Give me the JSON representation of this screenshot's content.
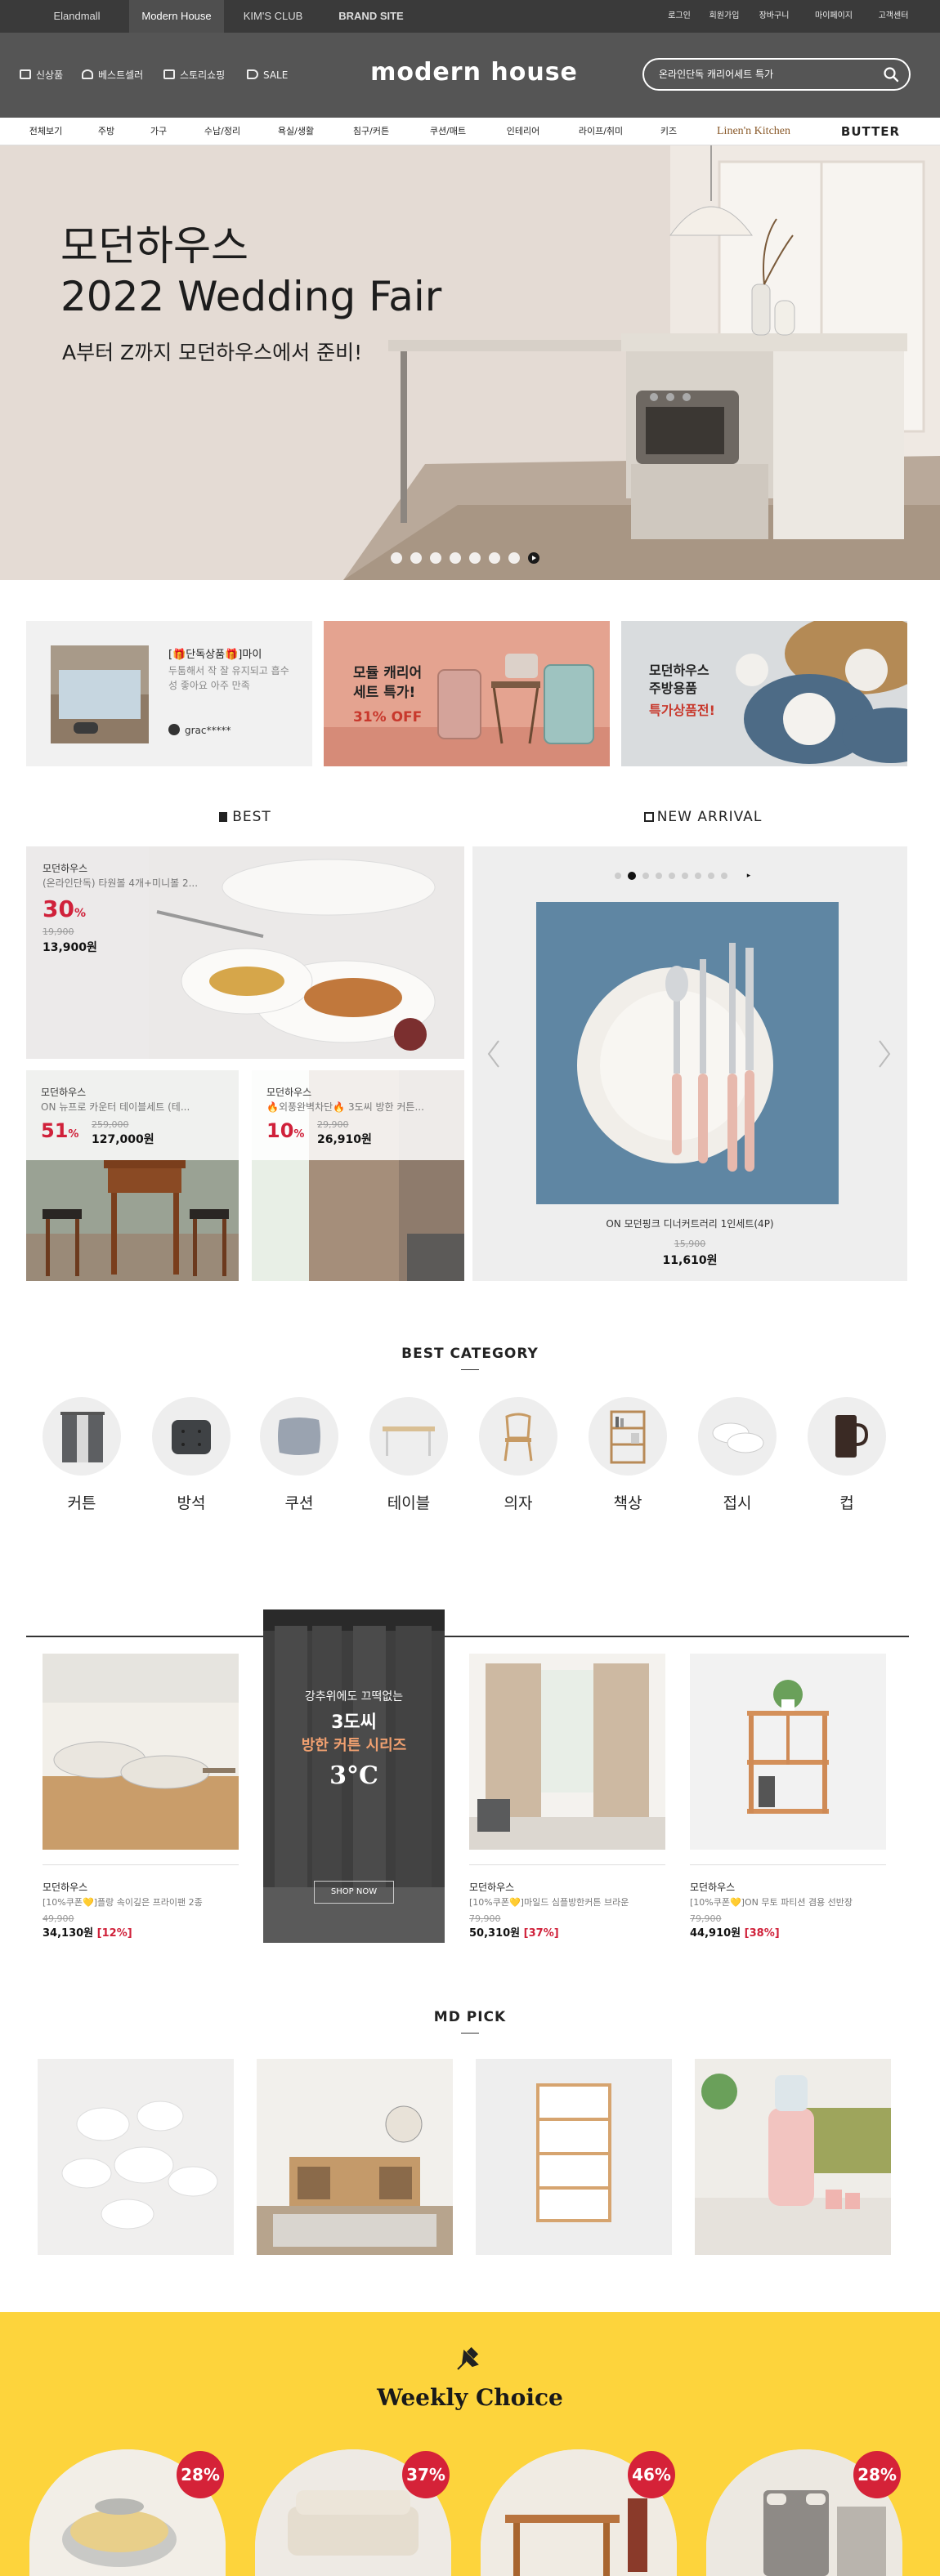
{
  "topbar": {
    "brands": [
      "Elandmall",
      "Modern House",
      "KIM'S CLUB",
      "BRAND SITE"
    ],
    "links": [
      "로그인",
      "회원가입",
      "장바구니",
      "마이페이지",
      "고객센터"
    ]
  },
  "header": {
    "shortcuts": [
      "신상품",
      "베스트셀러",
      "스토리쇼핑",
      "SALE"
    ],
    "logo": "modern house",
    "search_placeholder": "온라인단독 캐리어세트 특가"
  },
  "catnav": [
    "전체보기",
    "주방",
    "가구",
    "수납/정리",
    "욕실/생활",
    "침구/커튼",
    "쿠션/매트",
    "인테리어",
    "라이프/취미",
    "키즈",
    "Linen'n Kitchen",
    "BUTTER"
  ],
  "hero": {
    "title_line1": "모던하우스",
    "title_line2": "2022 Wedding Fair",
    "subtitle": "A부터 Z까지 모던하우스에서 준비!",
    "dot_count": 7
  },
  "promos": {
    "review": {
      "title": "[🎁단독상품🎁]마이",
      "text": "두툼해서 작 잘 유지되고 흡수성 좋아요 아주 만족",
      "user": "grac*****"
    },
    "carrier": {
      "line1": "모듈 캐리어",
      "line2": "세트 특가!",
      "discount": "31% OFF"
    },
    "kitchen": {
      "line1": "모던하우스",
      "line2": "주방용품",
      "line3": "특가상품전!"
    }
  },
  "best": {
    "heading": "BEST",
    "items": [
      {
        "brand": "모던하우스",
        "desc": "(온라인단독) 타원볼 4개+미니볼 2...",
        "pct": "30",
        "old": "19,900",
        "price": "13,900원"
      },
      {
        "brand": "모던하우스",
        "desc": "ON 뉴프로 카운터 테이블세트 (테...",
        "pct": "51",
        "old": "259,000",
        "price": "127,000원"
      },
      {
        "brand": "모던하우스",
        "desc": "🔥외풍완벽차단🔥 3도씨 방한 커튼...",
        "pct": "10",
        "old": "29,900",
        "price": "26,910원"
      }
    ]
  },
  "new_arrival": {
    "heading": "NEW ARRIVAL",
    "name": "ON 모던핑크 디너커트러리 1인세트(4P)",
    "old": "15,900",
    "price": "11,610원",
    "dot_count": 10
  },
  "best_category": {
    "heading": "BEST CATEGORY",
    "items": [
      "커튼",
      "방석",
      "쿠션",
      "테이블",
      "의자",
      "책상",
      "접시",
      "컵"
    ]
  },
  "curtain_banner": {
    "line1": "강추위에도 끄떡없는",
    "line2": "3도씨",
    "line3": "방한 커튼 시리즈",
    "badge": "3°C",
    "button": "SHOP NOW"
  },
  "products": [
    {
      "brand": "모던하우스",
      "desc": "[10%쿠폰💛]플랑 속이깊은 프라이팬 2종",
      "old": "49,900",
      "price": "34,130원",
      "disc": "[12%]"
    },
    {
      "brand": "모던하우스",
      "desc": "[10%쿠폰💛]마일드 심플방한커튼 브라운",
      "old": "79,900",
      "price": "50,310원",
      "disc": "[37%]"
    },
    {
      "brand": "모던하우스",
      "desc": "[10%쿠폰💛]ON 무토 파티션 겸용 선반장",
      "old": "79,900",
      "price": "44,910원",
      "disc": "[38%]"
    }
  ],
  "md_pick": {
    "heading": "MD PICK"
  },
  "weekly": {
    "heading": "Weekly Choice",
    "badges": [
      "28%",
      "37%",
      "46%",
      "28%"
    ]
  },
  "colors": {
    "accent": "#d0213a",
    "header_bg": "#555555",
    "topbar_bg": "#3a3a3a",
    "weekly_bg": "#fdd43c"
  }
}
